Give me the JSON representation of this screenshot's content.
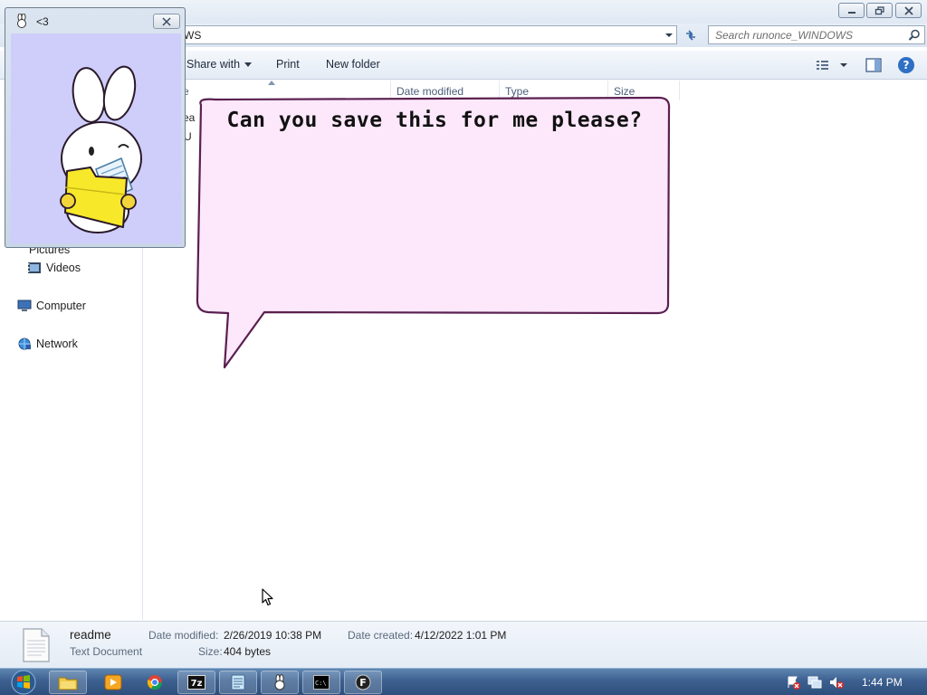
{
  "explorer": {
    "address_text": "WS",
    "search_placeholder": "Search runonce_WINDOWS",
    "toolbar": {
      "share_with": "Share with",
      "print": "Print",
      "new_folder": "New folder"
    },
    "nav": {
      "pictures": "Pictures",
      "videos": "Videos",
      "computer": "Computer",
      "network": "Network"
    },
    "columns": {
      "name": "e",
      "date_modified": "Date modified",
      "type": "Type",
      "size": "Size"
    },
    "files": [
      {
        "name": "ea"
      },
      {
        "name": "U"
      }
    ]
  },
  "details": {
    "file_name": "readme",
    "file_type": "Text Document",
    "date_modified_label": "Date modified:",
    "date_modified_value": "2/26/2019 10:38 PM",
    "date_created_label": "Date created:",
    "date_created_value": "4/12/2022 1:01 PM",
    "size_label": "Size:",
    "size_value": "404 bytes"
  },
  "mascot_window": {
    "title": "<3"
  },
  "speech_bubble": {
    "text": "Can you save this for me please?"
  },
  "taskbar": {
    "clock": "1:44 PM",
    "pinned": [
      "start-orb-icon",
      "explorer-icon",
      "media-player-icon",
      "chrome-icon",
      "7zip-icon",
      "notepad-icon",
      "bunny-app-icon",
      "cmd-icon",
      "f-app-icon"
    ]
  },
  "colors": {
    "bubble_fill": "#fde8fb",
    "bubble_stroke": "#5a2050",
    "mascot_bg": "#cfcdfa",
    "folder_yellow": "#f7e92a"
  }
}
